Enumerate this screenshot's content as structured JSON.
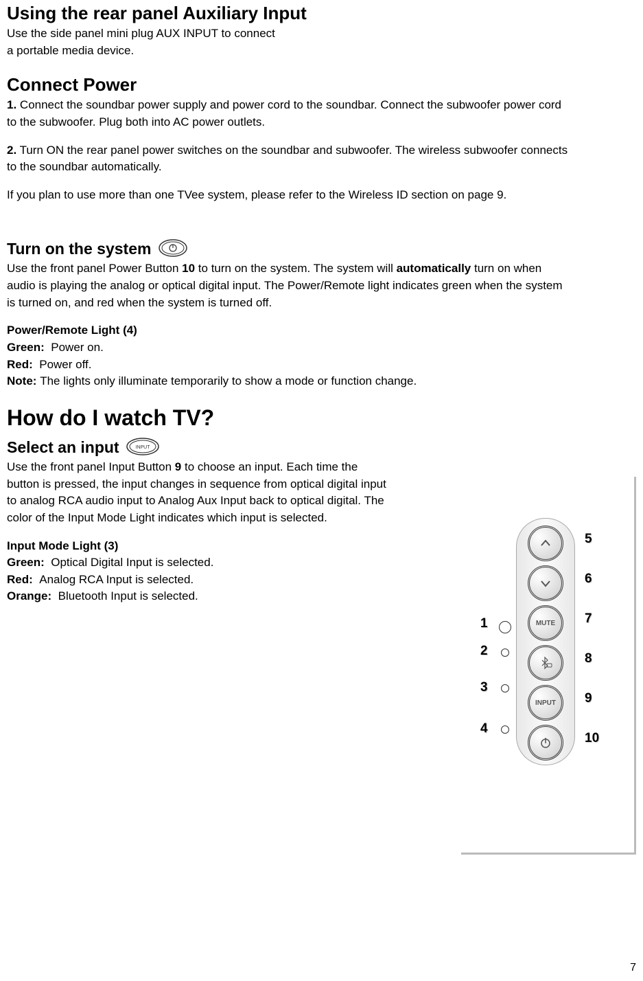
{
  "auxInput": {
    "heading": "Using the rear panel Auxiliary Input",
    "p1": "Use the side panel mini plug AUX INPUT to connect",
    "p2": "a portable media device."
  },
  "connectPower": {
    "heading": "Connect Power",
    "s1label": "1.",
    "s1": " Connect the soundbar power supply and power cord to the soundbar. Connect the subwoofer power cord to the subwoofer. Plug both into AC power outlets.",
    "s2label": "2.",
    "s2": " Turn ON the rear panel power switches on the soundbar and subwoofer. The wireless subwoofer connects to the soundbar automatically.",
    "note": "If you plan to use more than one TVee system, please refer to the Wireless ID section on page 9."
  },
  "turnOn": {
    "heading": "Turn on the system",
    "p_a": "Use the front panel Power Button ",
    "p_num": "10",
    "p_b": " to turn on the system. The system will ",
    "p_bold": "automatically",
    "p_c": " turn on when audio is playing the analog or optical digital input. The Power/Remote light indicates green when the system is turned on, and red when the system is turned off.",
    "lightHeading": "Power/Remote Light (4)",
    "greenLabel": "Green:",
    "green": "Power on.",
    "redLabel": "Red:",
    "red": "Power off.",
    "noteLabel": "Note:",
    "note": "The lights only illuminate temporarily to show a mode or function change."
  },
  "watchTV": {
    "heading": "How do I watch TV?"
  },
  "selectInput": {
    "heading": "Select an input",
    "p_a": "Use the front panel Input Button ",
    "p_num": "9",
    "p_b": " to choose an input. Each time the button is pressed, the input changes in sequence from optical digital input to analog RCA audio input to Analog Aux Input back to optical digital. The color of the Input Mode Light indicates which input is selected.",
    "lightHeading": "Input Mode Light (3)",
    "greenLabel": "Green:",
    "green": "Optical Digital Input is selected.",
    "redLabel": "Red:",
    "red": "Analog RCA Input is selected.",
    "orangeLabel": "Orange:",
    "orange": "Bluetooth Input is selected."
  },
  "panel": {
    "btnMute": "MUTE",
    "btnInput": "INPUT",
    "callouts": {
      "c1": "1",
      "c2": "2",
      "c3": "3",
      "c4": "4",
      "c5": "5",
      "c6": "6",
      "c7": "7",
      "c8": "8",
      "c9": "9",
      "c10": "10"
    }
  },
  "pageNumber": "7"
}
